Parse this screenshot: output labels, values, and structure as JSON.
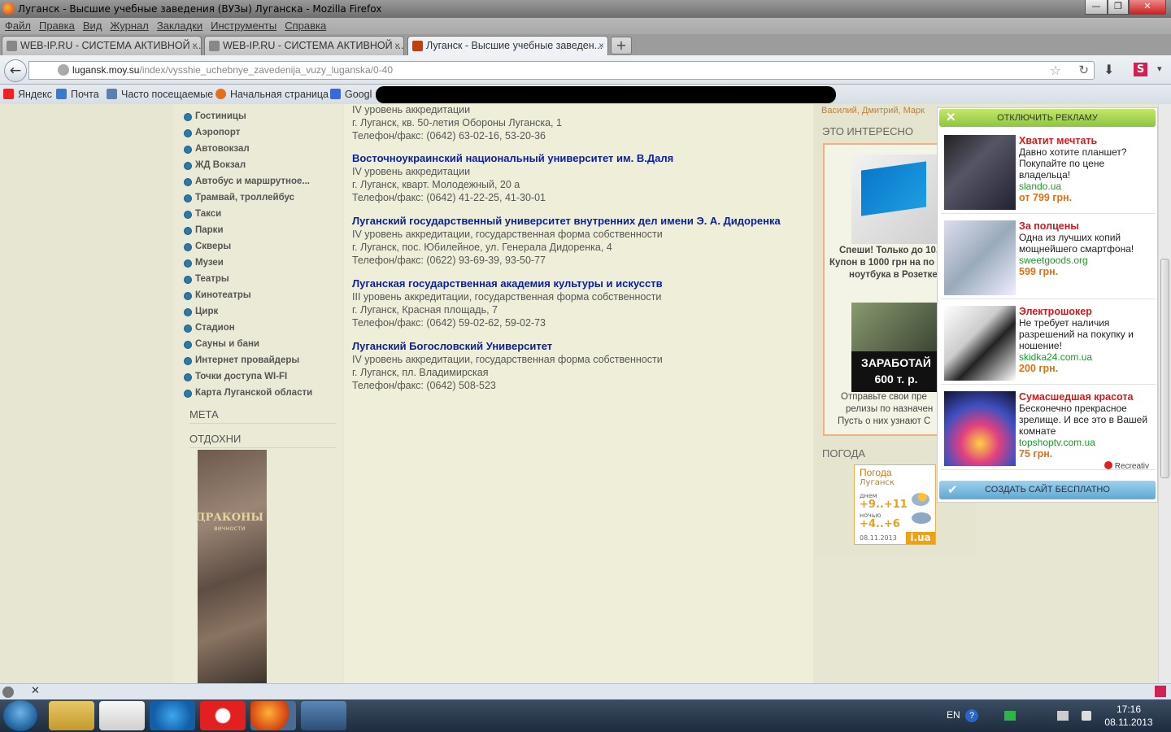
{
  "window": {
    "title": "Луганск - Высшие учебные заведения (ВУЗы) Луганска - Mozilla Firefox",
    "minimize": "—",
    "maximize": "❐",
    "close": "✕"
  },
  "menu": [
    "Файл",
    "Правка",
    "Вид",
    "Журнал",
    "Закладки",
    "Инструменты",
    "Справка"
  ],
  "tabs": [
    {
      "label": "WEB-IP.RU - СИСТЕМА АКТИВНОЙ ...",
      "close": "×"
    },
    {
      "label": "WEB-IP.RU - СИСТЕМА АКТИВНОЙ ...",
      "close": "×"
    },
    {
      "label": "Луганск - Высшие учебные заведен...",
      "close": "×"
    }
  ],
  "new_tab": "+",
  "nav": {
    "back": "←",
    "url_domain": "lugansk.moy.su",
    "url_path": "/index/vysshie_uchebnye_zavedenija_vuzy_luganska/0-40",
    "star": "☆",
    "reload": "↻",
    "download": "⬇",
    "addon": "S",
    "more": "▾"
  },
  "bookmarks": [
    "Яндекс",
    "Почта",
    "Часто посещаемые",
    "Начальная страница",
    "Googl"
  ],
  "sidebar": {
    "items": [
      "Гостиницы",
      "Аэропорт",
      "Автовокзал",
      "ЖД Вокзал",
      "Автобус и маршрутное...",
      "Трамвай, троллейбус",
      "Такси",
      "Парки",
      "Скверы",
      "Музеи",
      "Театры",
      "Кинотеатры",
      "Цирк",
      "Стадион",
      "Сауны и бани",
      "Интернет провайдеры",
      "Точки доступа WI-FI",
      "Карта Луганской области"
    ],
    "meta_heading": "МЕТА",
    "relax_heading": "ОТДОХНИ",
    "banner_text": "ДРАКОНЫ",
    "banner_sub": "вечности"
  },
  "universities": [
    {
      "name": "",
      "lines": [
        "IV уровень аккредитации",
        "г. Луганск, кв. 50-летия Обороны Луганска, 1",
        "Телефон/факс:     (0642) 63-02-16, 53-20-36"
      ]
    },
    {
      "name": "Восточноукраинский национальный университет им. В.Даля",
      "lines": [
        "IV уровень аккредитации",
        "г. Луганск, кварт. Молодежный, 20 а",
        "Телефон/факс:     (0642) 41-22-25, 41-30-01"
      ]
    },
    {
      "name": "Луганский государственный университет внутренних дел имени Э. А. Дидоренка",
      "lines": [
        "IV уровень аккредитации, государственная форма собственности",
        "г. Луганск, пос. Юбилейное, ул. Генерала Дидоренка, 4",
        "Телефон/факс: (0622) 93-69-39, 93-50-77"
      ]
    },
    {
      "name": "Луганская государственная академия культуры и искусств",
      "lines": [
        "III уровень аккредитации, государственная форма собственности",
        "г. Луганск, Красная площадь, 7",
        "Телефон/факс: (0642) 59-02-62, 59-02-73"
      ]
    },
    {
      "name": "Луганский Богословский Университет",
      "lines": [
        "IV уровень аккредитации, государственная форма собственности",
        "г. Луганск, пл. Владимирская",
        "Телефон/факс: (0642) 508-523"
      ]
    }
  ],
  "right": {
    "authors": "Василий, Дмитрий, Марк",
    "interesting_heading": "ЭТО ИНТЕРЕСНО",
    "ad1_lines": [
      "Спеши! Только до 10.",
      "Купон в 1000 грн на по",
      "ноутбука в Розетке"
    ],
    "ad2_banner": [
      "ЗАРАБОТАЙ",
      "600 т. р."
    ],
    "ad2_lines": [
      "Отправьте свои пре",
      "релизы по назначен",
      "Пусть о них узнают С"
    ],
    "weather_heading": "ПОГОДА",
    "weather": {
      "title": "Погода",
      "city": "Луганск",
      "day_label": "днем",
      "day_temp": "+9..+11",
      "night_label": "ночью",
      "night_temp": "+4..+6",
      "date": "08.11.2013",
      "brand": "i.ua"
    }
  },
  "ads": {
    "disable": "ОТКЛЮЧИТЬ РЕКЛАМУ",
    "items": [
      {
        "title": "Хватит мечтать",
        "desc": "Давно хотите планшет? Покупайте по цене владельца!",
        "domain": "slando.ua",
        "price": "от 799 грн."
      },
      {
        "title": "За полцены",
        "desc": "Одна из лучших копий мощнейшего смартфона!",
        "domain": "sweetgoods.org",
        "price": "599 грн."
      },
      {
        "title": "Электрошокер",
        "desc": "Не требует наличия разрешений на покупку и ношение!",
        "domain": "skidka24.com.ua",
        "price": "200 грн."
      },
      {
        "title": "Сумасшедшая красота",
        "desc": "Бесконечно прекрасное зрелище. И все это в Вашей комнате",
        "domain": "topshoptv.com.ua",
        "price": "75 грн."
      }
    ],
    "network": "Recreativ",
    "create_site": "СОЗДАТЬ САЙТ БЕСПЛАТНО"
  },
  "taskbar": {
    "lang": "EN",
    "time": "17:16",
    "date": "08.11.2013"
  },
  "colors": {
    "link": "#0b1f9a",
    "ad_title": "#d01a1a",
    "ad_price": "#e07010",
    "ad_domain": "#1a9a2a"
  }
}
